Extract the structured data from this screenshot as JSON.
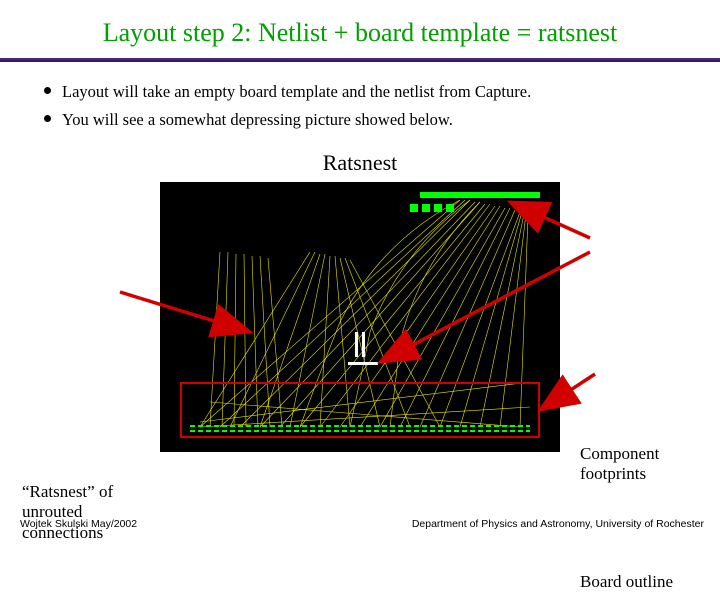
{
  "title": "Layout step 2: Netlist + board template = ratsnest",
  "bullets": [
    "Layout will take an empty board template and the netlist from Capture.",
    "You will see a somewhat depressing picture showed below."
  ],
  "subhead": "Ratsnest",
  "annotations": {
    "left": "“Ratsnest” of unrouted connections",
    "right_top": "Component footprints",
    "right_bottom": "Board outline"
  },
  "footer": {
    "left": "Wojtek Skulski May/2002",
    "right": "Department of Physics and Astronomy, University of Rochester"
  }
}
